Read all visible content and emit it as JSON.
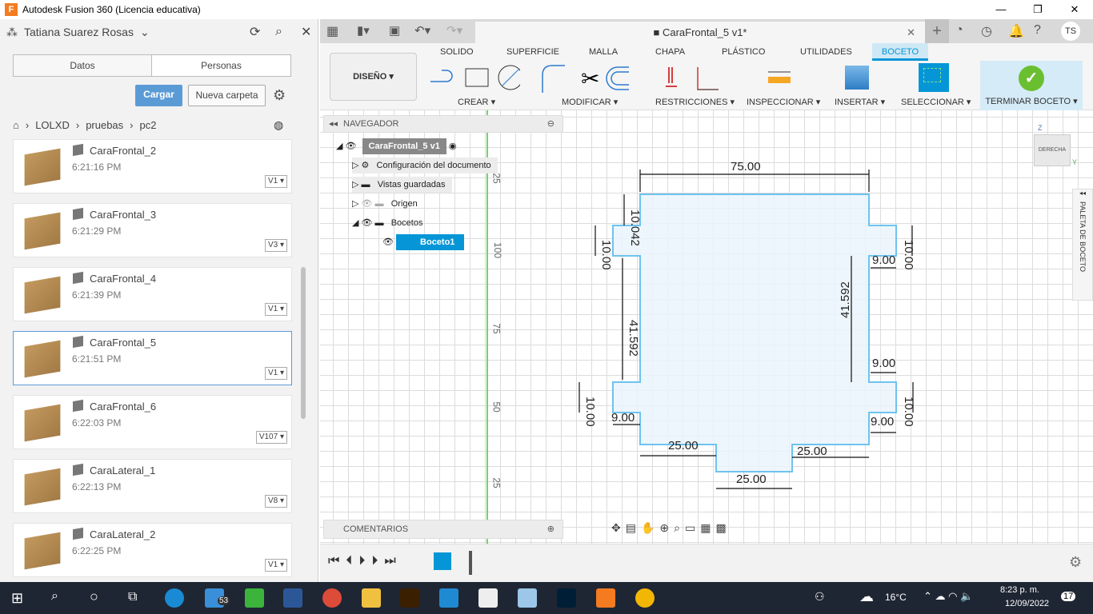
{
  "window": {
    "title": "Autodesk Fusion 360 (Licencia educativa)",
    "min": "—",
    "max": "❐",
    "close": "✕"
  },
  "left": {
    "user": "Tatiana Suarez Rosas",
    "tabs": [
      "Datos",
      "Personas"
    ],
    "upload": "Cargar",
    "new_folder": "Nueva carpeta",
    "breadcrumb": [
      "LOLXD",
      "pruebas",
      "pc2"
    ],
    "items": [
      {
        "name": "CaraFrontal_2",
        "time": "6:21:16 PM",
        "version": "V1"
      },
      {
        "name": "CaraFrontal_3",
        "time": "6:21:29 PM",
        "version": "V3"
      },
      {
        "name": "CaraFrontal_4",
        "time": "6:21:39 PM",
        "version": "V1"
      },
      {
        "name": "CaraFrontal_5",
        "time": "6:21:51 PM",
        "version": "V1"
      },
      {
        "name": "CaraFrontal_6",
        "time": "6:22:03 PM",
        "version": "V107"
      },
      {
        "name": "CaraLateral_1",
        "time": "6:22:13 PM",
        "version": "V8"
      },
      {
        "name": "CaraLateral_2",
        "time": "6:22:25 PM",
        "version": "V1"
      }
    ]
  },
  "doc": {
    "tab": "CaraFrontal_5 v1*",
    "user_initials": "TS"
  },
  "ribbon": {
    "workspace": "DISEÑO",
    "tabs": [
      "SOLIDO",
      "SUPERFICIE",
      "MALLA",
      "CHAPA",
      "PLÁSTICO",
      "UTILIDADES",
      "BOCETO"
    ],
    "groups": [
      "CREAR",
      "MODIFICAR",
      "RESTRICCIONES",
      "INSPECCIONAR",
      "INSERTAR",
      "SELECCIONAR",
      "TERMINAR BOCETO"
    ]
  },
  "navigator": {
    "title": "NAVEGADOR",
    "root": "CaraFrontal_5 v1",
    "nodes": [
      "Configuración del documento",
      "Vistas guardadas",
      "Origen",
      "Bocetos"
    ],
    "sketch": "Boceto1"
  },
  "comments": "COMENTARIOS",
  "viewcube": {
    "face": "DERECHA",
    "z": "Z",
    "y": "Y"
  },
  "palette": "PALETA DE BOCETO",
  "ruler": [
    "100",
    "75",
    "50",
    "25",
    "25"
  ],
  "dimensions": {
    "top": "75.00",
    "tl": "10.042",
    "l1": "10.00",
    "l2": "41.592",
    "l3": "10.00",
    "l4": "9.00",
    "r1": "10.00",
    "r2": "9.00",
    "r3": "41.592",
    "r4": "9.00",
    "r5": "10.00",
    "r6": "9.00",
    "b1": "25.00",
    "b2": "25.00",
    "b3": "25.00"
  },
  "taskbar": {
    "mail_count": "53",
    "temp": "16°C",
    "time": "8:23 p. m.",
    "date": "12/09/2022",
    "notif": "17"
  },
  "colors": {
    "accent": "#0696d7",
    "sketch_line": "#6ec3ee",
    "sketch_fill": "#eaf4fb",
    "finish": "#6abf30"
  }
}
